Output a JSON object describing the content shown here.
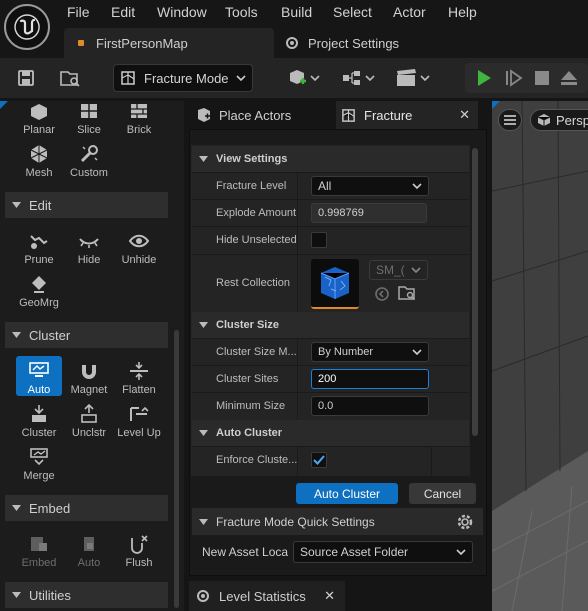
{
  "menu": [
    "File",
    "Edit",
    "Window",
    "Tools",
    "Build",
    "Select",
    "Actor",
    "Help"
  ],
  "tabs": {
    "level": "FirstPersonMap",
    "project_settings": "Project Settings"
  },
  "toolbar": {
    "mode": "Fracture Mode"
  },
  "left": {
    "top_tools": [
      "Planar",
      "Slice",
      "Brick",
      "Mesh",
      "Custom"
    ],
    "edit": {
      "title": "Edit",
      "tools": [
        "Prune",
        "Hide",
        "Unhide",
        "GeoMrg"
      ]
    },
    "cluster": {
      "title": "Cluster",
      "tools": [
        "Auto",
        "Magnet",
        "Flatten",
        "Cluster",
        "Unclstr",
        "Level Up",
        "Merge"
      ]
    },
    "embed": {
      "title": "Embed",
      "tools": [
        "Embed",
        "Auto",
        "Flush"
      ]
    },
    "utilities": {
      "title": "Utilities"
    }
  },
  "panel": {
    "tab_place": "Place Actors",
    "tab_fracture": "Fracture",
    "view_settings": {
      "title": "View Settings",
      "fracture_level": {
        "label": "Fracture Level",
        "value": "All"
      },
      "explode_amount": {
        "label": "Explode Amount",
        "value": "0.998769"
      },
      "hide_unselected": {
        "label": "Hide Unselected"
      },
      "rest_collection": {
        "label": "Rest Collection",
        "asset": "SM_("
      }
    },
    "cluster_size": {
      "title": "Cluster Size",
      "method": {
        "label": "Cluster Size M...",
        "value": "By Number"
      },
      "sites": {
        "label": "Cluster Sites",
        "value": "200"
      },
      "min_size": {
        "label": "Minimum Size",
        "value": "0.0"
      }
    },
    "auto_cluster": {
      "title": "Auto Cluster",
      "enforce": {
        "label": "Enforce Cluste..."
      }
    },
    "buttons": {
      "auto_cluster": "Auto Cluster",
      "cancel": "Cancel"
    },
    "quick_settings": {
      "title": "Fracture Mode Quick Settings",
      "new_asset": {
        "label": "New Asset Loca",
        "value": "Source Asset Folder"
      }
    },
    "level_stats": "Level Statistics"
  },
  "viewport": {
    "view_label": "Persp"
  },
  "colors": {
    "accent": "#0e70c0",
    "play_green": "#3fb43f",
    "selected_tool": "#0e70c0",
    "details_bg": "#242424"
  }
}
